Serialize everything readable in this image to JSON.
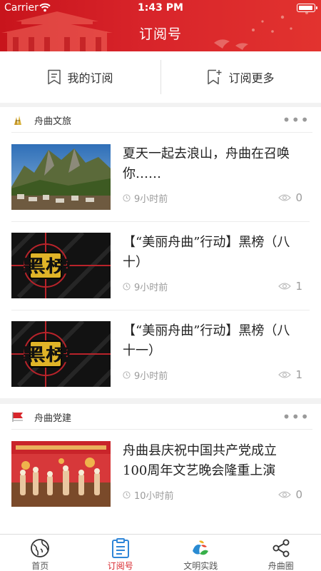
{
  "status_bar": {
    "carrier": "Carrier",
    "time": "1:43 PM"
  },
  "header": {
    "title": "订阅号"
  },
  "sub_bar": {
    "my_subscriptions": "我的订阅",
    "subscribe_more": "订阅更多"
  },
  "sections": [
    {
      "source": "舟曲文旅",
      "articles": [
        {
          "title": "夏天一起去浪山，舟曲在召唤你……",
          "time": "9小时前",
          "views": "0"
        },
        {
          "title": "【“美丽舟曲”行动】黑榜（八十）",
          "time": "9小时前",
          "views": "1",
          "thumb_text": "黑榜"
        },
        {
          "title": "【“美丽舟曲”行动】黑榜（八十一）",
          "time": "9小时前",
          "views": "1",
          "thumb_text": "黑榜"
        }
      ]
    },
    {
      "source": "舟曲党建",
      "articles": [
        {
          "title": "舟曲县庆祝中国共产党成立100周年文艺晚会隆重上演",
          "time": "10小时前",
          "views": "0"
        }
      ]
    }
  ],
  "tabbar": {
    "tabs": [
      {
        "label": "首页",
        "icon": "globe-icon"
      },
      {
        "label": "订阅号",
        "icon": "clipboard-icon",
        "active": true
      },
      {
        "label": "文明实践",
        "icon": "civilization-logo-icon"
      },
      {
        "label": "舟曲圈",
        "icon": "share-icon"
      }
    ]
  },
  "colors": {
    "brand_red": "#d8252b",
    "header_red": "#d8242a",
    "muted_text": "#9b9b9b"
  }
}
